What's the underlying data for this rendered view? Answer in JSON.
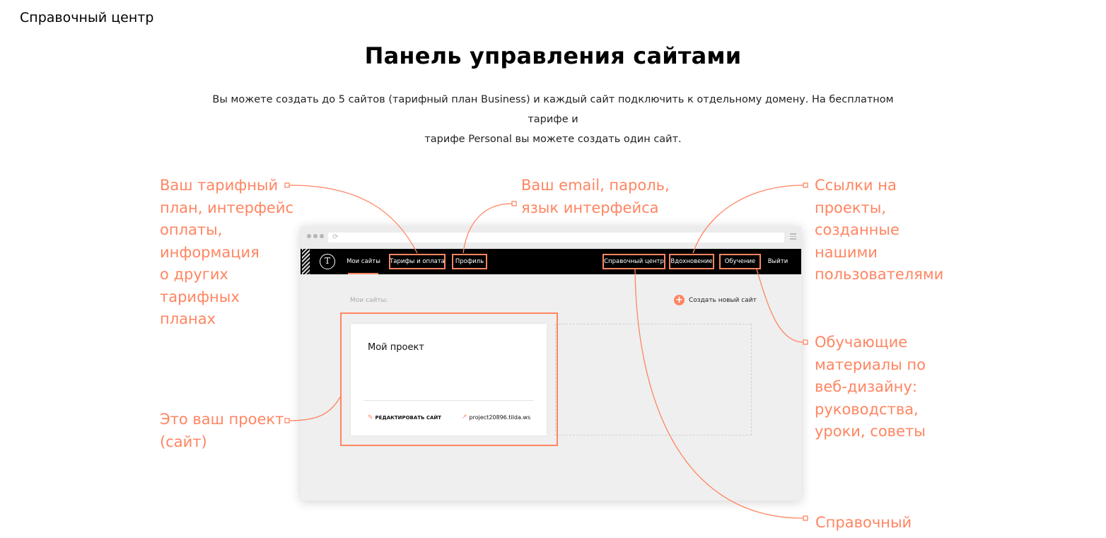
{
  "header": {
    "title": "Справочный центр"
  },
  "page": {
    "title": "Панель управления сайтами",
    "subtitle_line1": "Вы можете создать до 5 сайтов (тарифный план Business) и каждый сайт подключить к отдельному домену. На бесплатном тарифе и",
    "subtitle_line2": "тарифе Personal вы можете создать один сайт."
  },
  "annotations": {
    "tariff": [
      "Ваш тарифный",
      "план, интерфейс",
      "оплаты,",
      "информация",
      "о других",
      "тарифных",
      "планах"
    ],
    "profile": [
      "Ваш email, пароль,",
      "язык интерфейса"
    ],
    "inspiration": [
      "Ссылки на",
      "проекты,",
      "созданные",
      "нашими",
      "пользователями"
    ],
    "education": [
      "Обучающие",
      "материалы по",
      "веб-дизайну:",
      "руководства,",
      "уроки, советы"
    ],
    "project": [
      "Это ваш проект",
      "(сайт)"
    ],
    "help": [
      "Справочный"
    ]
  },
  "mockup": {
    "logo": "T",
    "nav": {
      "my_sites": "Мои сайты",
      "tariffs": "Тарифы и оплата",
      "profile": "Профиль",
      "help": "Справочный центр",
      "inspiration": "Вдохновение",
      "education": "Обучение",
      "logout": "Выйти"
    },
    "content_label": "Мои сайты:",
    "create_label": "Создать новый сайт",
    "project": {
      "title": "Мой проект",
      "edit_label": "РЕДАКТИРОВАТЬ САЙТ",
      "site_url": "project20896.tilda.ws"
    }
  },
  "colors": {
    "accent": "#ff8562",
    "navbar": "#000000",
    "workspace": "#efefef"
  },
  "icons": [
    "logo-icon",
    "reload-icon",
    "menu-icon",
    "plus-icon",
    "pencil-icon",
    "external-link-icon"
  ]
}
